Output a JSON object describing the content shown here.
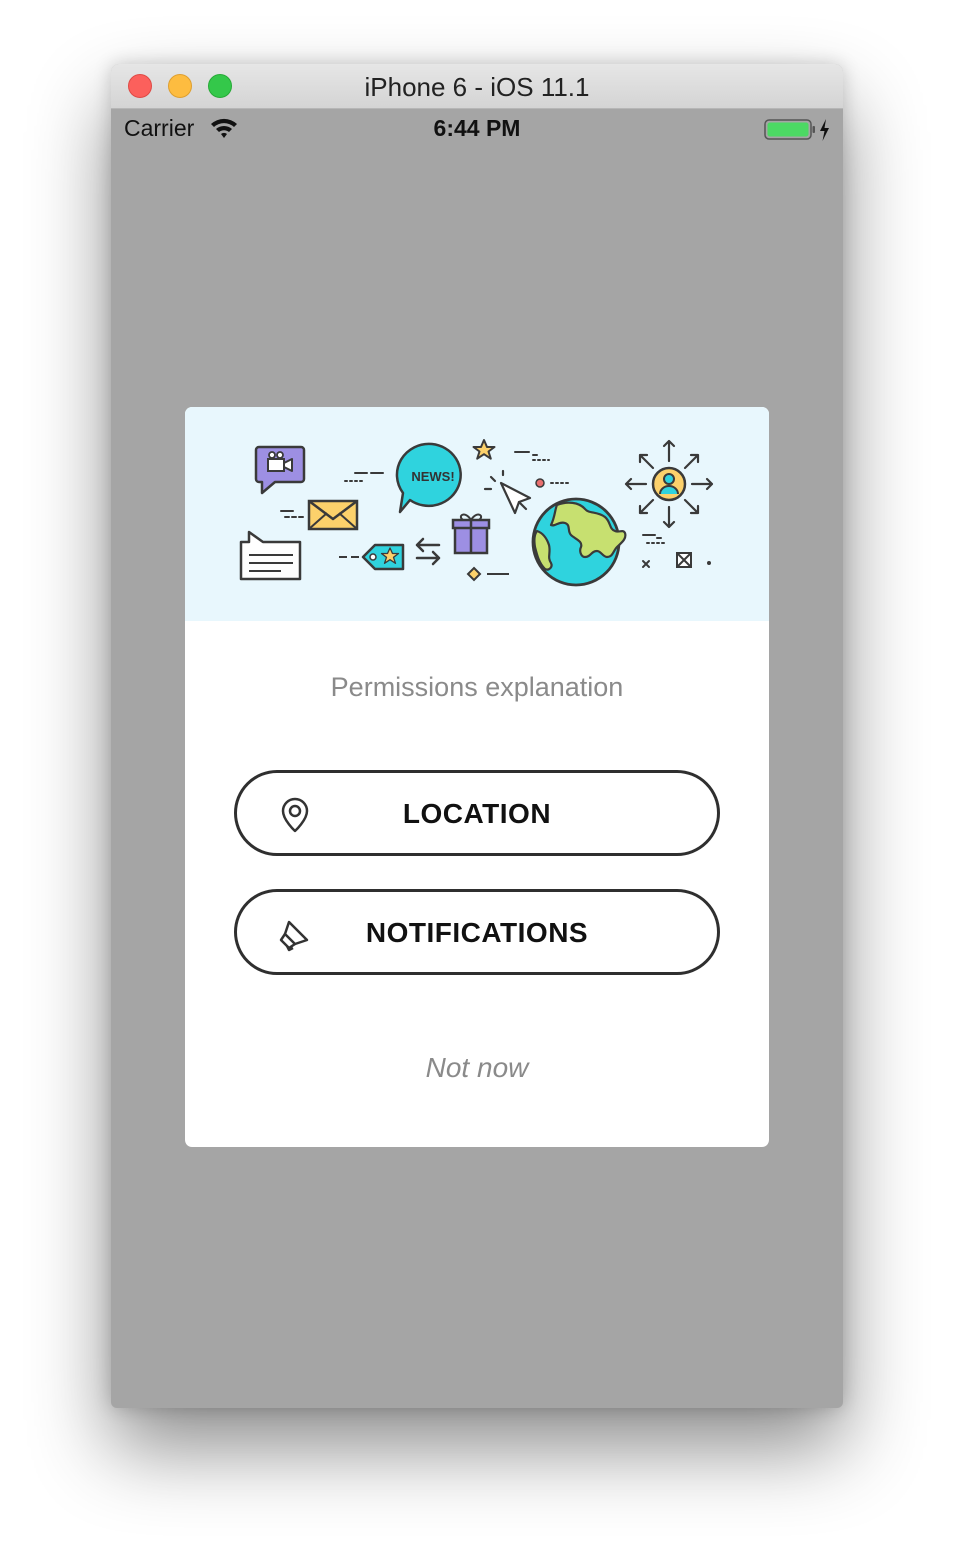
{
  "window": {
    "title": "iPhone 6 - iOS 11.1"
  },
  "statusbar": {
    "carrier": "Carrier",
    "time": "6:44 PM",
    "battery_level": 1.0,
    "charging": true
  },
  "dialog": {
    "banner_news_text": "NEWS!",
    "explanation": "Permissions explanation",
    "buttons": [
      {
        "label": "LOCATION",
        "icon": "map-pin-icon"
      },
      {
        "label": "NOTIFICATIONS",
        "icon": "megaphone-icon"
      }
    ],
    "dismiss_label": "Not now"
  },
  "colors": {
    "dimmed_background": "#a5a5a5",
    "banner_background": "#e8f7fd",
    "button_border": "#2f2f2f",
    "secondary_text": "#8a8a8a",
    "battery_fill": "#4cd964"
  }
}
